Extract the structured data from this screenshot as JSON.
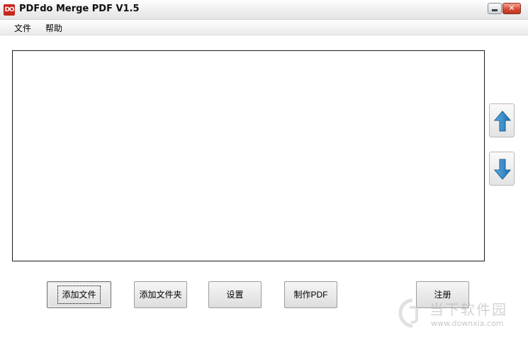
{
  "window": {
    "app_icon_text": "DO",
    "title": "PDFdo Merge PDF V1.5",
    "close_glyph": "✕"
  },
  "menu": {
    "items": [
      "文件",
      "帮助"
    ]
  },
  "side_buttons": {
    "up_icon": "arrow-up-icon",
    "down_icon": "arrow-down-icon",
    "arrow_color": "#2f87c4"
  },
  "buttons": {
    "add_file": "添加文件",
    "add_folder": "添加文件夹",
    "settings": "设置",
    "make_pdf": "制作PDF",
    "register": "注册"
  },
  "watermark": {
    "name": "当下软件园",
    "url": "www.downxia.com"
  }
}
